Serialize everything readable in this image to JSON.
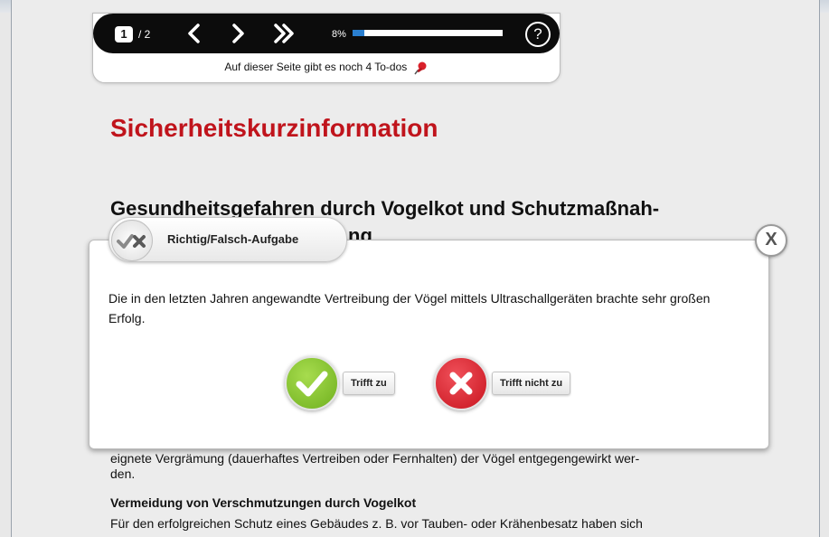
{
  "toolbar": {
    "current_page": "1",
    "total_pages": "/ 2",
    "progress_text": "8%",
    "progress_value": 0.08,
    "todo_text": "Auf dieser Seite gibt es noch 4 To-dos"
  },
  "content": {
    "title": "Sicherheitskurzinformation",
    "subtitle": "Gesundheitsgefahren durch Vogelkot und Schutzmaßnah-",
    "subtitle_continued": "ng",
    "paragraph_line1": "eignete Vergrämung (dauerhaftes Vertreiben oder Fernhalten) der Vögel entgegengewirkt wer-",
    "paragraph_line2": "den.",
    "section_heading": "Vermeidung von Verschmutzungen durch Vogelkot",
    "section_text": "Für den erfolgreichen Schutz eines Gebäudes z. B. vor Tauben- oder Krähenbesatz haben sich"
  },
  "dialog": {
    "title": "Richtig/Falsch-Aufgabe",
    "question": "Die in den letzten Jahren angewandte Vertreibung der Vögel mittels Ultraschallgeräten brachte sehr großen Erfolg.",
    "true_label": "Trifft zu",
    "false_label": "Trifft nicht zu",
    "close_symbol": "X"
  },
  "colors": {
    "title_red": "#c0141c",
    "true_green": "#7cbc2a",
    "false_red": "#d9202a",
    "progress_blue": "#2a7fd0"
  }
}
